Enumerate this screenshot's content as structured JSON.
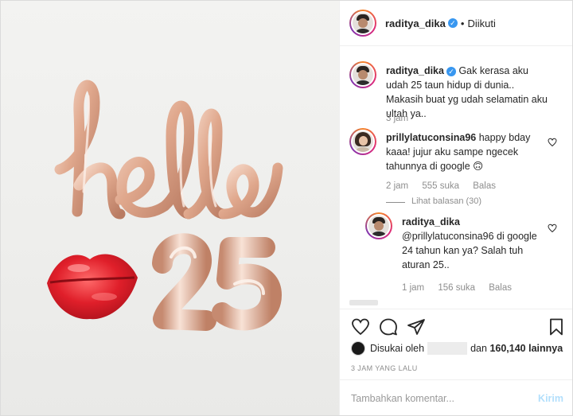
{
  "header": {
    "username": "raditya_dika",
    "separator": "•",
    "follow_status": "Diikuti"
  },
  "photo": {
    "word": "hello",
    "number": "25"
  },
  "comments": [
    {
      "username": "raditya_dika",
      "text": "Gak kerasa aku udah 25 taun hidup di dunia.. Makasih buat yg udah selamatin aku ultah ya..",
      "time": "3 jam"
    },
    {
      "username": "prillylatuconsina96",
      "text": "happy bday kaaa! jujur aku sampe ngecek tahunnya di google 🙃",
      "time": "2 jam",
      "likes": "555 suka",
      "reply": "Balas",
      "view_replies": "Lihat balasan (30)"
    },
    {
      "username": "raditya_dika",
      "text": "@prillylatuconsina96 di google 24 tahun kan ya? Salah tuh aturan 25..",
      "time": "1 jam",
      "likes": "156 suka",
      "reply": "Balas"
    }
  ],
  "likes_bar": {
    "prefix": "Disukai oleh",
    "middle": "dan",
    "count": "160,140 lainnya"
  },
  "timestamp": "3 JAM YANG LALU",
  "comment_box": {
    "placeholder": "Tambahkan komentar...",
    "post_label": "Kirim"
  },
  "colors": {
    "verified": "#3897f0",
    "post_button": "#b2dffc",
    "balloon_gold": "#e8b9a0",
    "lips": "#d8202a"
  }
}
